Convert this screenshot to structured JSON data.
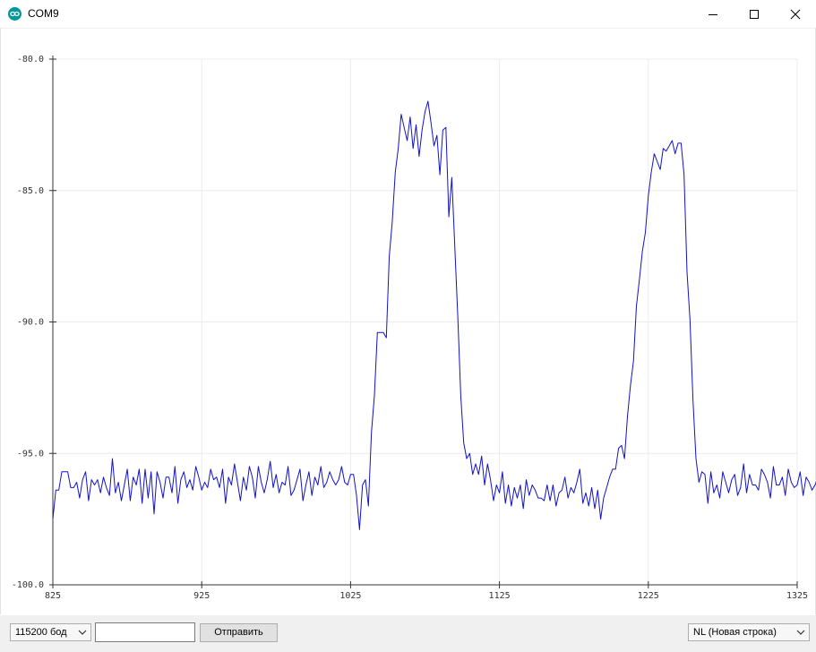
{
  "window": {
    "title": "COM9",
    "app_icon": "arduino-icon",
    "controls": [
      "minimize-icon",
      "maximize-icon",
      "close-icon"
    ]
  },
  "bottom_bar": {
    "baud_rate": "115200 бод",
    "message_value": "",
    "send_label": "Отправить",
    "line_ending": "NL (Новая строка)"
  },
  "colors": {
    "series": "#1212c8",
    "grid": "#ececec",
    "axis": "#333333",
    "app_icon": "#00979c"
  },
  "chart_data": {
    "type": "line",
    "title": "",
    "xlabel": "",
    "ylabel": "",
    "xlim": [
      825,
      1325
    ],
    "ylim": [
      -100,
      -80
    ],
    "x_ticks": [
      "825",
      "925",
      "1025",
      "1125",
      "1225",
      "1325"
    ],
    "y_ticks": [
      "-80.0",
      "-85.0",
      "-90.0",
      "-95.0",
      "-100.0"
    ],
    "x_tick_values": [
      825,
      925,
      1025,
      1125,
      1225,
      1325
    ],
    "y_tick_values": [
      -80,
      -85,
      -90,
      -95,
      -100
    ],
    "grid": true,
    "series": [
      {
        "x_start": 825,
        "x_step": 2,
        "values": [
          -97.5,
          -96.4,
          -96.4,
          -95.7,
          -95.7,
          -95.7,
          -96.3,
          -96.3,
          -96.1,
          -96.7,
          -96.0,
          -95.7,
          -96.8,
          -96.0,
          -96.2,
          -96.0,
          -96.5,
          -95.9,
          -96.3,
          -96.6,
          -95.2,
          -96.5,
          -96.1,
          -96.8,
          -96.2,
          -95.6,
          -96.8,
          -95.9,
          -96.2,
          -95.6,
          -96.9,
          -95.6,
          -96.7,
          -95.7,
          -97.3,
          -95.7,
          -96.1,
          -96.7,
          -95.9,
          -95.9,
          -96.5,
          -95.5,
          -96.9,
          -96.0,
          -95.7,
          -96.3,
          -96.0,
          -96.4,
          -95.5,
          -95.9,
          -96.4,
          -96.1,
          -96.3,
          -95.6,
          -96.0,
          -95.9,
          -96.3,
          -95.6,
          -96.9,
          -95.9,
          -96.2,
          -95.4,
          -96.1,
          -96.8,
          -95.9,
          -96.4,
          -95.5,
          -95.9,
          -96.7,
          -95.5,
          -96.1,
          -96.5,
          -96.0,
          -95.3,
          -96.3,
          -95.8,
          -96.5,
          -96.1,
          -96.2,
          -95.5,
          -96.6,
          -96.4,
          -96.0,
          -95.6,
          -96.8,
          -96.2,
          -95.7,
          -96.6,
          -95.9,
          -96.2,
          -95.5,
          -96.3,
          -96.1,
          -95.7,
          -96.0,
          -96.2,
          -96.0,
          -95.5,
          -96.1,
          -96.2,
          -95.8,
          -95.8,
          -96.6,
          -97.9,
          -96.2,
          -96.0,
          -97.0,
          -94.2,
          -92.8,
          -90.4,
          -90.4,
          -90.4,
          -90.6,
          -87.5,
          -86.2,
          -84.3,
          -83.4,
          -82.1,
          -82.6,
          -83.1,
          -82.2,
          -83.4,
          -82.5,
          -83.7,
          -82.7,
          -82.0,
          -81.6,
          -82.4,
          -83.3,
          -82.9,
          -84.4,
          -82.7,
          -82.6,
          -86.0,
          -84.5,
          -87.1,
          -89.8,
          -92.8,
          -94.6,
          -95.2,
          -95.0,
          -95.8,
          -95.4,
          -95.8,
          -95.1,
          -96.2,
          -95.4,
          -96.0,
          -96.8,
          -96.2,
          -96.5,
          -95.7,
          -96.9,
          -96.2,
          -97.0,
          -96.3,
          -96.7,
          -96.2,
          -97.1,
          -96.0,
          -96.6,
          -96.2,
          -96.4,
          -96.7,
          -96.7,
          -96.8,
          -96.2,
          -96.8,
          -96.2,
          -97.0,
          -96.5,
          -96.4,
          -95.9,
          -96.7,
          -96.3,
          -96.5,
          -96.1,
          -95.6,
          -96.9,
          -96.5,
          -97.0,
          -96.3,
          -97.1,
          -96.4,
          -97.5,
          -96.7,
          -96.3,
          -95.9,
          -95.6,
          -95.6,
          -94.8,
          -94.7,
          -95.2,
          -93.6,
          -92.4,
          -91.5,
          -89.4,
          -88.4,
          -87.3,
          -86.6,
          -85.2,
          -84.3,
          -83.6,
          -83.9,
          -84.2,
          -83.4,
          -83.5,
          -83.3,
          -83.1,
          -83.6,
          -83.2,
          -83.2,
          -84.4,
          -88.1,
          -89.9,
          -93.0,
          -95.2,
          -96.1,
          -95.7,
          -95.8,
          -96.9,
          -95.7,
          -96.5,
          -96.2,
          -96.7,
          -95.7,
          -96.1,
          -96.5,
          -96.0,
          -95.8,
          -96.6,
          -96.3,
          -95.4,
          -96.5,
          -95.8,
          -96.2,
          -96.2,
          -96.4,
          -95.6,
          -95.8,
          -96.1,
          -96.7,
          -95.5,
          -96.2,
          -96.2,
          -95.9,
          -96.6,
          -95.6,
          -96.1,
          -96.3,
          -96.2,
          -95.7,
          -96.6,
          -95.9,
          -96.1,
          -96.4,
          -96.2,
          -95.9,
          -96.2,
          -96.5,
          -95.9,
          -96.0,
          -96.2,
          -95.9,
          -96.1,
          -96.3,
          -95.9,
          -95.8,
          -96.2,
          -95.6,
          -96.3,
          -96.6,
          -96.0,
          -96.2,
          -96.2,
          -96.4
        ]
      }
    ]
  }
}
